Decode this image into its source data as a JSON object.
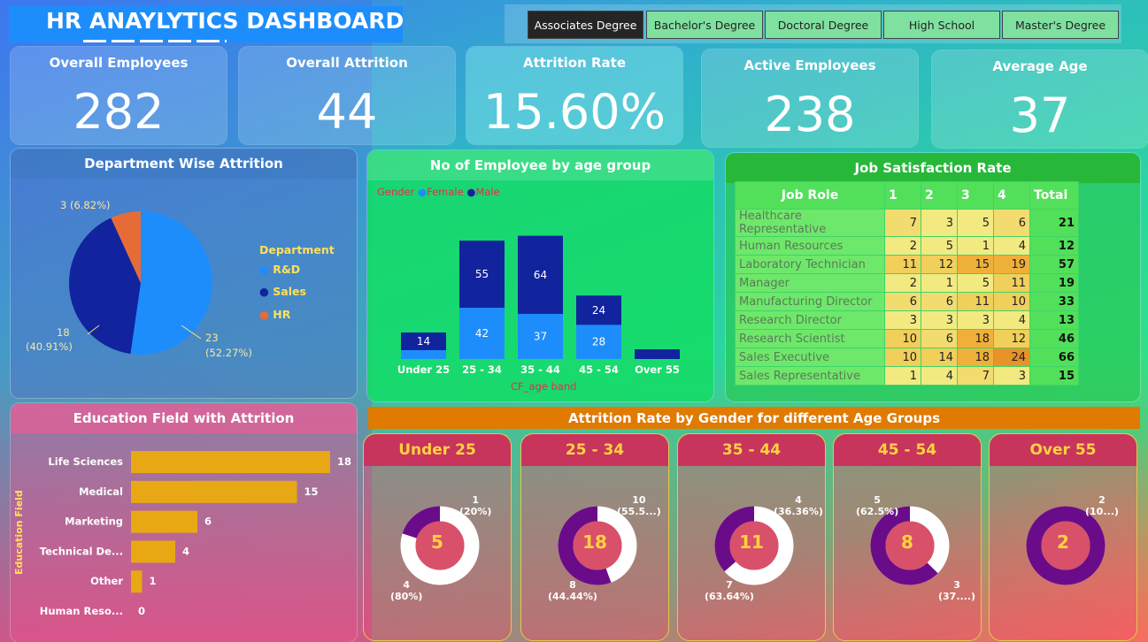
{
  "header": {
    "title": "HR ANAYLYTICS DASHBOARD"
  },
  "slicer": {
    "items": [
      "Associates Degree",
      "Bachelor's Degree",
      "Doctoral Degree",
      "High School",
      "Master's Degree"
    ],
    "selected": "Associates Degree"
  },
  "kpis": [
    {
      "label": "Overall Employees",
      "value": "282"
    },
    {
      "label": "Overall Attrition",
      "value": "44"
    },
    {
      "label": "Attrition Rate",
      "value": "15.60%"
    },
    {
      "label": "Active Employees",
      "value": "238"
    },
    {
      "label": "Average Age",
      "value": "37"
    }
  ],
  "dept": {
    "title": "Department Wise Attrition",
    "legend_title": "Department",
    "legend": [
      {
        "name": "R&D",
        "color": "#1e8dfc"
      },
      {
        "name": "Sales",
        "color": "#12239e"
      },
      {
        "name": "HR",
        "color": "#e66c37"
      }
    ],
    "labels": {
      "rd": "23",
      "rd_pct": "(52.27%)",
      "sales": "18",
      "sales_pct": "(40.91%)",
      "hr": "3 (6.82%)"
    }
  },
  "age": {
    "title": "No of Employee by age group",
    "legend_title": "Gender",
    "legend_female": "Female",
    "legend_male": "Male",
    "xlabel": "CF_age band"
  },
  "job": {
    "title": "Job Satisfaction Rate",
    "columns": [
      "Job Role",
      "1",
      "2",
      "3",
      "4",
      "Total"
    ],
    "rows": [
      {
        "role": "Healthcare Representative",
        "v": [
          "7",
          "3",
          "5",
          "6"
        ],
        "total": "21"
      },
      {
        "role": "Human Resources",
        "v": [
          "2",
          "5",
          "1",
          "4"
        ],
        "total": "12"
      },
      {
        "role": "Laboratory Technician",
        "v": [
          "11",
          "12",
          "15",
          "19"
        ],
        "total": "57"
      },
      {
        "role": "Manager",
        "v": [
          "2",
          "1",
          "5",
          "11"
        ],
        "total": "19"
      },
      {
        "role": "Manufacturing Director",
        "v": [
          "6",
          "6",
          "11",
          "10"
        ],
        "total": "33"
      },
      {
        "role": "Research Director",
        "v": [
          "3",
          "3",
          "3",
          "4"
        ],
        "total": "13"
      },
      {
        "role": "Research Scientist",
        "v": [
          "10",
          "6",
          "18",
          "12"
        ],
        "total": "46"
      },
      {
        "role": "Sales Executive",
        "v": [
          "10",
          "14",
          "18",
          "24"
        ],
        "total": "66"
      },
      {
        "role": "Sales Representative",
        "v": [
          "1",
          "4",
          "7",
          "3"
        ],
        "total": "15"
      }
    ]
  },
  "edu": {
    "title": "Education Field with Attrition",
    "ylabel": "Education Field"
  },
  "gender": {
    "title": "Attrition Rate by Gender for different Age Groups",
    "groups": [
      {
        "name": "Under 25",
        "total": "5",
        "l1": "1",
        "l1b": "(20%)",
        "l2": "4",
        "l2b": "(80%)"
      },
      {
        "name": "25 - 34",
        "total": "18",
        "l1": "10",
        "l1b": "(55.5...)",
        "l2": "8",
        "l2b": "(44.44%)"
      },
      {
        "name": "35 - 44",
        "total": "11",
        "l1": "4",
        "l1b": "(36.36%)",
        "l2": "7",
        "l2b": "(63.64%)"
      },
      {
        "name": "45 - 54",
        "total": "8",
        "l1": "5",
        "l1b": "(62.5%)",
        "l2": "3",
        "l2b": "(37....)"
      },
      {
        "name": "Over 55",
        "total": "2",
        "l1": "2",
        "l1b": "(10...)",
        "l2": "",
        "l2b": ""
      }
    ]
  },
  "colors": {
    "female": "#1e8dfc",
    "male": "#12239e",
    "edu_bar": "#e8a814",
    "donut_male": "#6a0c8a",
    "donut_female": "#ffffff"
  },
  "chart_data": [
    {
      "type": "pie",
      "title": "Department Wise Attrition",
      "categories": [
        "R&D",
        "Sales",
        "HR"
      ],
      "values": [
        23,
        18,
        3
      ],
      "percent": [
        52.27,
        40.91,
        6.82
      ]
    },
    {
      "type": "bar",
      "title": "No of Employee by age group",
      "xlabel": "CF_age band",
      "categories": [
        "Under 25",
        "25 - 34",
        "35 - 44",
        "45 - 54",
        "Over 55"
      ],
      "series": [
        {
          "name": "Female",
          "values": [
            4,
            42,
            37,
            28,
            0
          ]
        },
        {
          "name": "Male",
          "values": [
            14,
            55,
            64,
            24,
            2
          ]
        }
      ]
    },
    {
      "type": "bar",
      "title": "Education Field with Attrition",
      "ylabel": "Education Field",
      "categories": [
        "Life Sciences",
        "Medical",
        "Marketing",
        "Technical De...",
        "Other",
        "Human Reso..."
      ],
      "values": [
        18,
        15,
        6,
        4,
        1,
        0
      ]
    },
    {
      "type": "pie",
      "title": "Attrition Rate by Gender for different Age Groups",
      "categories": [
        "Under 25",
        "25 - 34",
        "35 - 44",
        "45 - 54",
        "Over 55"
      ],
      "series": [
        {
          "name": "Male",
          "values": [
            1,
            10,
            4,
            5,
            2
          ]
        },
        {
          "name": "Female",
          "values": [
            4,
            8,
            7,
            3,
            0
          ]
        }
      ]
    }
  ]
}
